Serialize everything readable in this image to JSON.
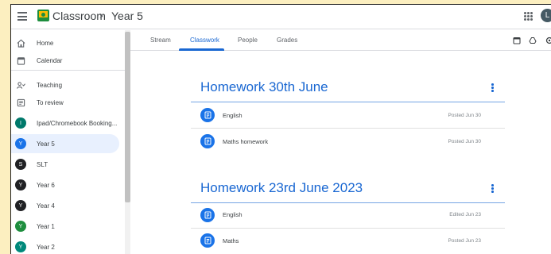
{
  "header": {
    "app_name": "Classroom",
    "separator": "›",
    "class_name": "Year 5",
    "avatar_letter": "L"
  },
  "sidebar": {
    "items": [
      {
        "label": "Home",
        "icon": "home-icon"
      },
      {
        "label": "Calendar",
        "icon": "calendar-icon"
      },
      {
        "label": "Teaching",
        "icon": "people-icon"
      },
      {
        "label": "To review",
        "icon": "review-icon"
      },
      {
        "label": "Ipad/Chromebook Booking...",
        "avatar": "I",
        "color": "#00796b"
      },
      {
        "label": "Year 5",
        "avatar": "Y",
        "color": "#1a73e8",
        "active": true
      },
      {
        "label": "SLT",
        "avatar": "S",
        "color": "#202124"
      },
      {
        "label": "Year 6",
        "avatar": "Y",
        "color": "#202124"
      },
      {
        "label": "Year 4",
        "avatar": "Y",
        "color": "#202124"
      },
      {
        "label": "Year 1",
        "avatar": "Y",
        "color": "#1e8e3e"
      },
      {
        "label": "Year 2",
        "avatar": "Y",
        "color": "#00897b"
      }
    ]
  },
  "tabs": [
    {
      "label": "Stream"
    },
    {
      "label": "Classwork",
      "active": true
    },
    {
      "label": "People"
    },
    {
      "label": "Grades"
    }
  ],
  "topics": [
    {
      "title": "Homework 30th June",
      "assignments": [
        {
          "title": "English",
          "date": "Posted Jun 30"
        },
        {
          "title": "Maths homework",
          "date": "Posted Jun 30"
        }
      ]
    },
    {
      "title": "Homework 23rd June 2023",
      "assignments": [
        {
          "title": "English",
          "date": "Edited Jun 23"
        },
        {
          "title": "Maths",
          "date": "Posted Jun 23"
        }
      ]
    }
  ],
  "colors": {
    "accent": "#1967d2",
    "active_bg": "#e8f0fe",
    "page_bg": "#fcefc0"
  }
}
